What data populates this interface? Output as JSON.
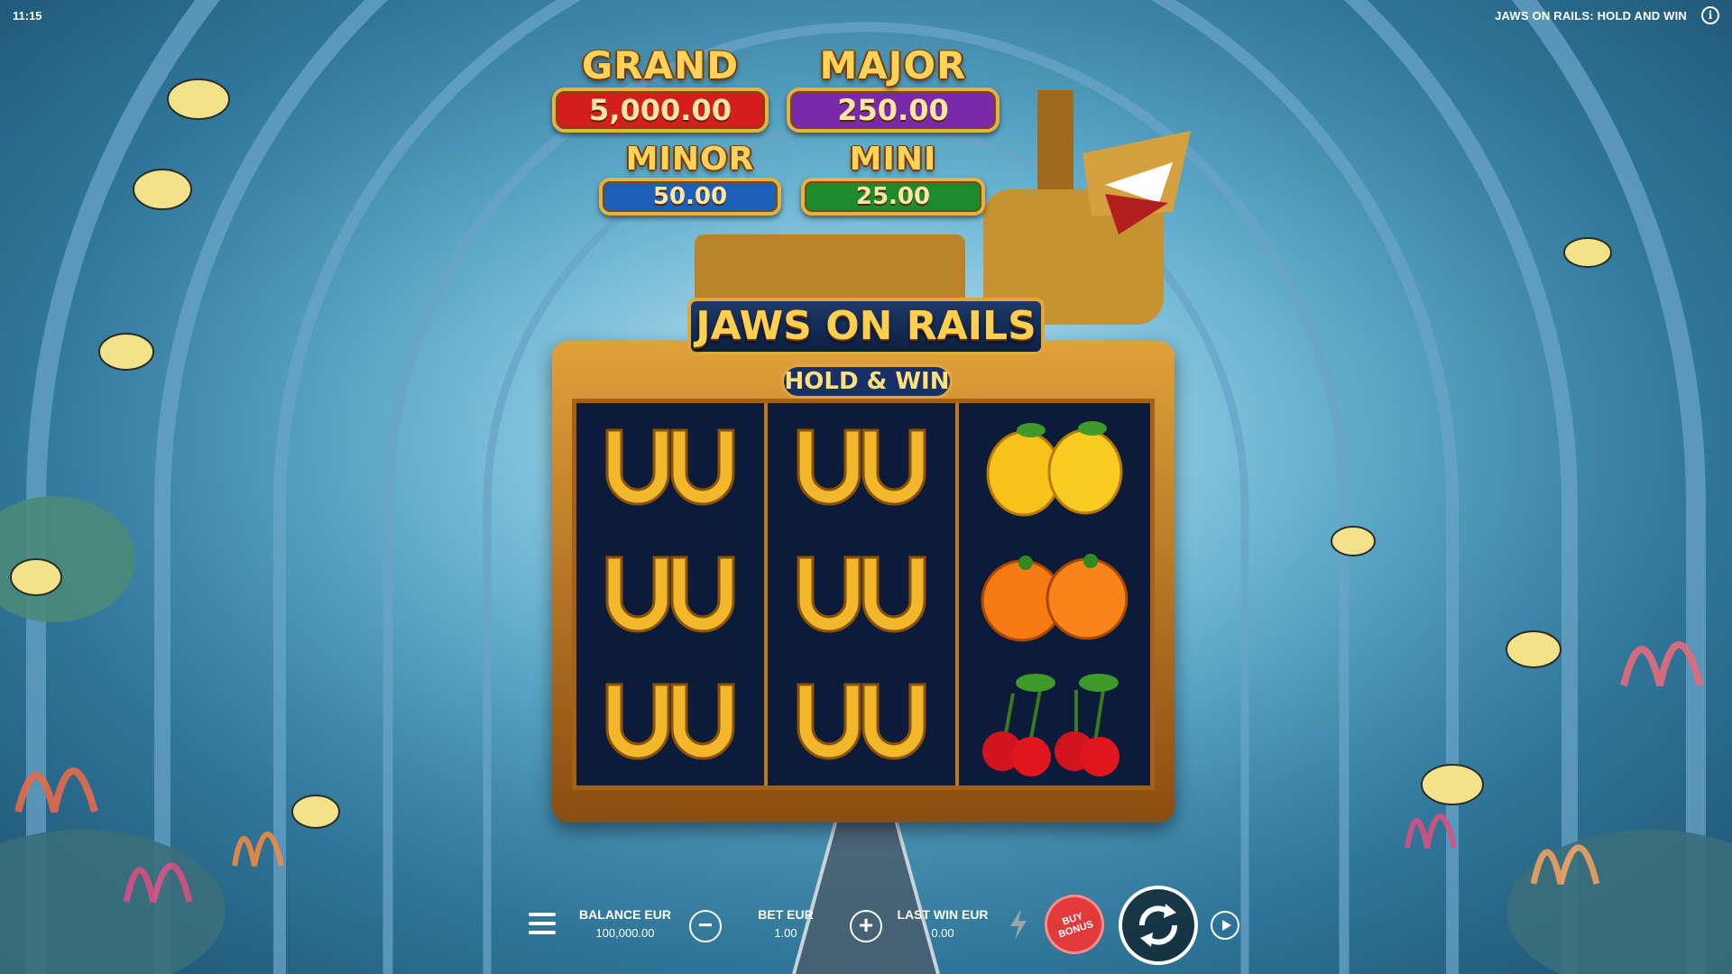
{
  "status": {
    "time": "11:15",
    "game_title": "JAWS ON RAILS: HOLD AND WIN"
  },
  "jackpots": {
    "grand": {
      "label": "GRAND",
      "value": "5,000.00",
      "color": "#d41e1e"
    },
    "major": {
      "label": "MAJOR",
      "value": "250.00",
      "color": "#7a2aa8"
    },
    "minor": {
      "label": "MINOR",
      "value": "50.00",
      "color": "#1b5fb8"
    },
    "mini": {
      "label": "MINI",
      "value": "25.00",
      "color": "#1e8a2e"
    }
  },
  "logo": {
    "title": "JAWS ON RAILS",
    "subtitle": "HOLD & WIN"
  },
  "reels": [
    [
      "horseshoes",
      "horseshoes",
      "horseshoes"
    ],
    [
      "horseshoes",
      "horseshoes",
      "horseshoes"
    ],
    [
      "lemons",
      "oranges",
      "cherries"
    ]
  ],
  "controls": {
    "balance_label": "BALANCE EUR",
    "balance_value": "100,000.00",
    "bet_label": "BET EUR",
    "bet_value": "1.00",
    "last_win_label": "LAST WIN EUR",
    "last_win_value": "0.00",
    "buy_bonus": "BUY BONUS"
  },
  "icons": [
    "menu-icon",
    "minus-icon",
    "plus-icon",
    "turbo-icon",
    "spin-icon",
    "autoplay-icon",
    "info-icon"
  ]
}
